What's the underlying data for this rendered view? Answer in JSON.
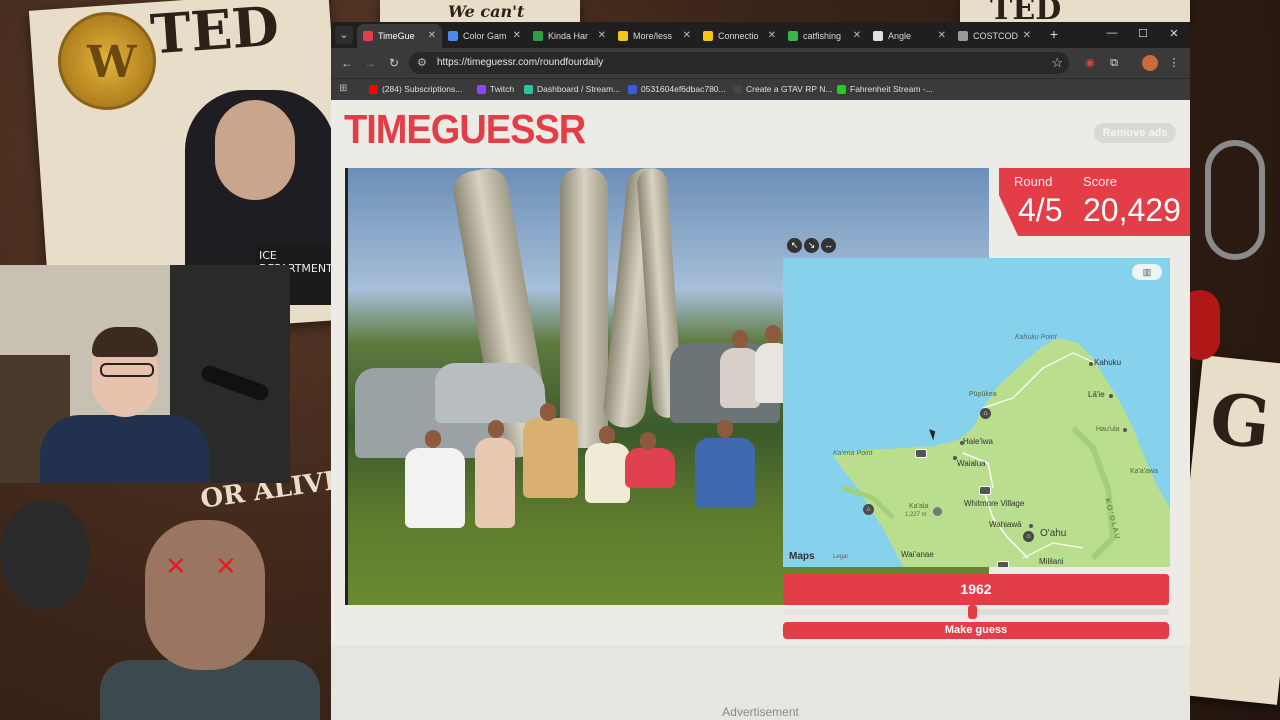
{
  "overlay": {
    "poster_left_text": "TED",
    "poster_top_text": "We can't expect",
    "poster_topright_text": "TED",
    "poster_right_text": "G",
    "coin_letter": "W",
    "tape_label": "ICE DEPARTMENT ILYA",
    "alive_text": "OR ALIVE"
  },
  "browser": {
    "tabs": [
      {
        "label": "TimeGue",
        "color": "#e33e48",
        "active": true
      },
      {
        "label": "Color Gam",
        "color": "#4a8af0",
        "active": false
      },
      {
        "label": "Kinda Har",
        "color": "#2ea043",
        "active": false
      },
      {
        "label": "More/less",
        "color": "#f5c518",
        "active": false
      },
      {
        "label": "Connectio",
        "color": "#f5c518",
        "active": false
      },
      {
        "label": "catfishing",
        "color": "#3bb54a",
        "active": false
      },
      {
        "label": "Angle",
        "color": "#e0e0e0",
        "active": false
      },
      {
        "label": "COSTCOD",
        "color": "#999999",
        "active": false
      }
    ],
    "url": "https://timeguessr.com/roundfourdaily",
    "bookmarks": [
      {
        "label": "(284) Subscriptions...",
        "color": "#ff0000"
      },
      {
        "label": "Twitch",
        "color": "#9146ff"
      },
      {
        "label": "Dashboard / Stream...",
        "color": "#2ec4a0"
      },
      {
        "label": "0531604ef6dbac780...",
        "color": "#3b5bdb"
      },
      {
        "label": "Create a GTAV RP N...",
        "color": "#444444"
      },
      {
        "label": "Fahrenheit Stream -...",
        "color": "#22cc22"
      }
    ]
  },
  "game": {
    "logo": "TIMEGUESSR",
    "remove_ads": "Remove ads",
    "round_label": "Round",
    "round_value": "4/5",
    "score_label": "Score",
    "score_value": "20,429",
    "year": "1962",
    "year_fraction": 0.49,
    "guess_button": "Make guess",
    "advertisement": "Advertisement",
    "map": {
      "brand": "Maps",
      "legal": "Legal",
      "layer_icon": "map-icon",
      "labels": {
        "kahuku_point": "Kahuku Point",
        "kahuku": "Kahuku",
        "pupukea": "Pūpūkea",
        "laie": "Lā'ie",
        "hauula": "Hau'ula",
        "haleiwa": "Hale'iwa",
        "waialua": "Waialua",
        "kaena_point": "Ka'ena Point",
        "kaala": "Ka'ala",
        "kaala_elev": "1,227 m",
        "whitmore": "Whitmore Village",
        "kaaawa": "Ka'a'awa",
        "wahiawa": "Wahiawā",
        "oahu": "O'ahu",
        "waianae": "Wai'anae",
        "mililani": "Mililani",
        "koolau": "K O ' O L A U"
      }
    }
  },
  "colors": {
    "accent": "#e33e48",
    "page_bg": "#ecebe5",
    "water": "#86d1ec",
    "land": "#b8de8e"
  }
}
